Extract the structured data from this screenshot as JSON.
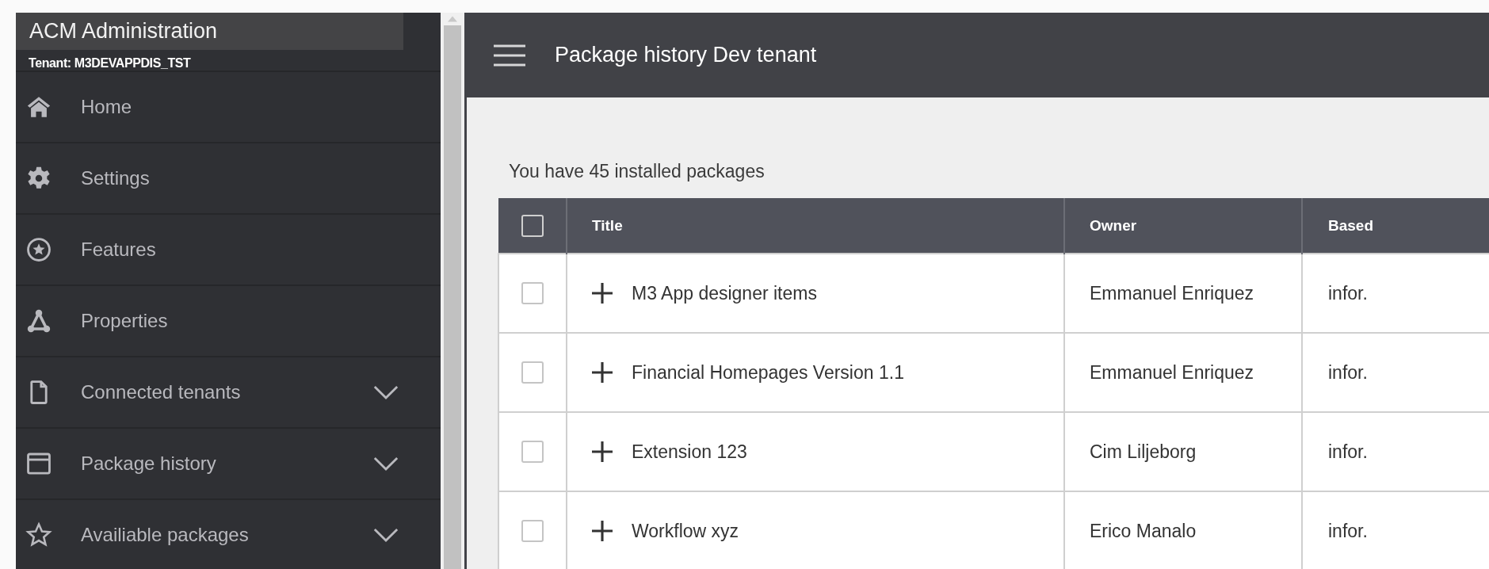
{
  "sidebar": {
    "title": "ACM Administration",
    "tenant": "Tenant: M3DEVAPPDIS_TST",
    "items": [
      {
        "label": "Home",
        "kind": "link"
      },
      {
        "label": "Settings",
        "kind": "link"
      },
      {
        "label": "Features",
        "kind": "link"
      },
      {
        "label": "Properties",
        "kind": "link"
      },
      {
        "label": "Connected tenants",
        "kind": "group",
        "expanded": false
      },
      {
        "label": "Package history",
        "kind": "group",
        "expanded": false
      },
      {
        "label": "Availiable packages",
        "kind": "group",
        "expanded": false
      }
    ]
  },
  "header": {
    "title": "Package history Dev tenant"
  },
  "summary": "You have 45 installed packages",
  "table": {
    "select_all": {
      "checked": false
    },
    "columns": [
      "Title",
      "Owner",
      "Based"
    ],
    "rows": [
      {
        "checked": false,
        "expanded": false,
        "title": "M3 App designer items",
        "owner": "Emmanuel Enriquez",
        "column_3": "infor."
      },
      {
        "checked": false,
        "expanded": false,
        "title": "Financial Homepages Version 1.1",
        "owner": "Emmanuel Enriquez",
        "column_3": "infor."
      },
      {
        "checked": false,
        "expanded": false,
        "title": "Extension 123",
        "owner": "Cim Liljeborg",
        "column_3": "infor."
      },
      {
        "checked": false,
        "expanded": false,
        "title": "Workflow xyz",
        "owner": "Erico Manalo",
        "column_3": "infor."
      }
    ]
  }
}
